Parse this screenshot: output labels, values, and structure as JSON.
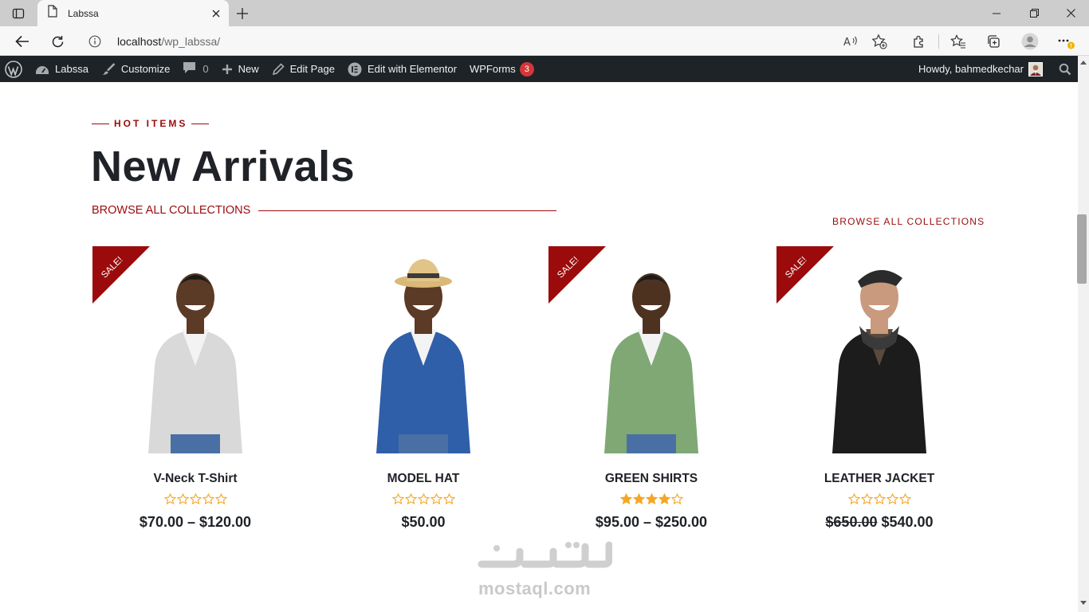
{
  "browser": {
    "tab_title": "Labssa",
    "url_host": "localhost",
    "url_path": "/wp_labssa/"
  },
  "wp_admin_bar": {
    "site_name": "Labssa",
    "customize": "Customize",
    "comments_count": "0",
    "new": "New",
    "edit_page": "Edit Page",
    "edit_with_elementor": "Edit with Elementor",
    "wpforms": "WPForms",
    "wpforms_badge": "3",
    "howdy": "Howdy, bahmedkechar"
  },
  "section": {
    "eyebrow": "HOT ITEMS",
    "title": "New Arrivals",
    "browse_left": "BROWSE ALL COLLECTIONS",
    "browse_right": "BROWSE ALL COLLECTIONS"
  },
  "sale_label": "SALE!",
  "products": [
    {
      "name": "V-Neck T-Shirt",
      "rating": 0,
      "price": "$70.00 – $120.00",
      "old_price": "",
      "on_sale": true,
      "shirt_color": "#d9d9d9",
      "skin_color": "#5b3a26"
    },
    {
      "name": "MODEL HAT",
      "rating": 0,
      "price": "$50.00",
      "old_price": "",
      "on_sale": false,
      "shirt_color": "#2f5fa8",
      "skin_color": "#5b3a26"
    },
    {
      "name": "GREEN SHIRTS",
      "rating": 4,
      "price": "$95.00 – $250.00",
      "old_price": "",
      "on_sale": true,
      "shirt_color": "#7fa875",
      "skin_color": "#4e3220"
    },
    {
      "name": "LEATHER JACKET",
      "rating": 0,
      "price": "$540.00",
      "old_price": "$650.00",
      "on_sale": true,
      "shirt_color": "#1c1c1c",
      "skin_color": "#c99a7d"
    }
  ],
  "colors": {
    "accent": "#9b0b0b",
    "star": "#f5a623",
    "wp_bar": "#1d2327"
  },
  "watermark": {
    "arabic": "مستقل",
    "latin": "mostaql.com"
  }
}
